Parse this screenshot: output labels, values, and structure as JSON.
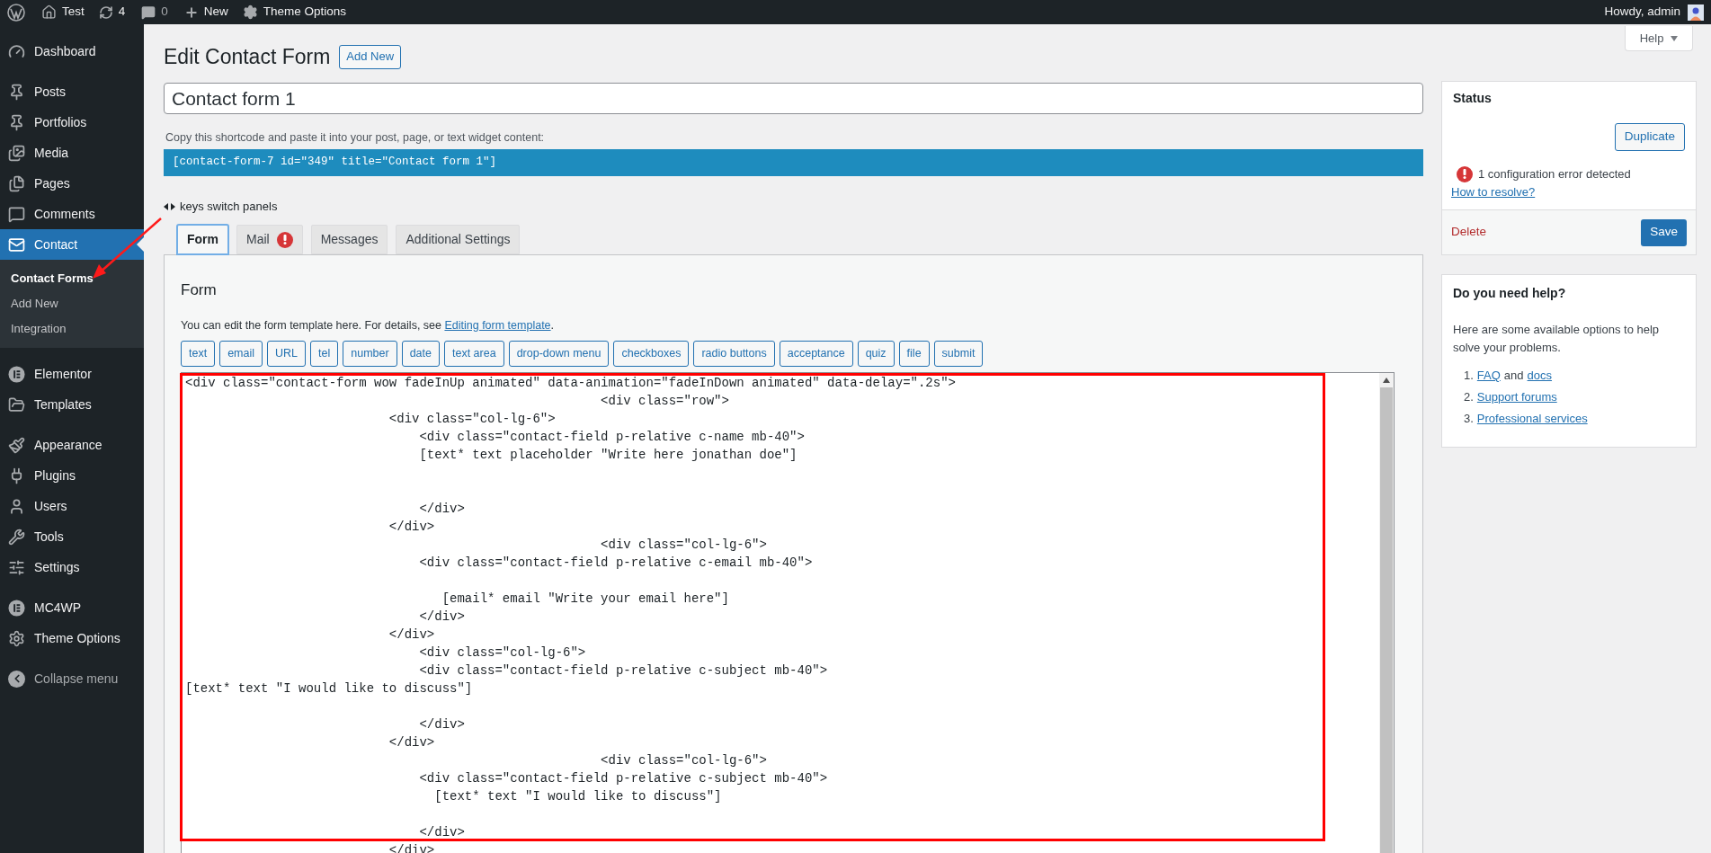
{
  "admin_bar": {
    "site": "Test",
    "updates": "4",
    "comments": "0",
    "new": "New",
    "theme_options": "Theme Options",
    "greeting": "Howdy, admin"
  },
  "sidebar": {
    "groups": [
      {
        "items": [
          {
            "label": "Dashboard",
            "selected": false
          }
        ]
      },
      {
        "items": [
          {
            "label": "Posts",
            "selected": false
          },
          {
            "label": "Portfolios",
            "selected": false
          },
          {
            "label": "Media",
            "selected": false
          },
          {
            "label": "Pages",
            "selected": false
          },
          {
            "label": "Comments",
            "selected": false
          },
          {
            "label": "Contact",
            "selected": true,
            "children": [
              {
                "label": "Contact Forms",
                "selected": true
              },
              {
                "label": "Add New",
                "selected": false
              },
              {
                "label": "Integration",
                "selected": false
              }
            ]
          }
        ]
      },
      {
        "items": [
          {
            "label": "Elementor",
            "selected": false
          },
          {
            "label": "Templates",
            "selected": false
          }
        ]
      },
      {
        "items": [
          {
            "label": "Appearance",
            "selected": false
          },
          {
            "label": "Plugins",
            "selected": false
          },
          {
            "label": "Users",
            "selected": false
          },
          {
            "label": "Tools",
            "selected": false
          },
          {
            "label": "Settings",
            "selected": false
          }
        ]
      },
      {
        "items": [
          {
            "label": "MC4WP",
            "selected": false
          },
          {
            "label": "Theme Options",
            "selected": false
          }
        ]
      }
    ],
    "collapse": "Collapse menu"
  },
  "help_tab": "Help",
  "page": {
    "title": "Edit Contact Form",
    "add_new": "Add New"
  },
  "form_title": {
    "value": "Contact form 1"
  },
  "shortcode": {
    "caption": "Copy this shortcode and paste it into your post, page, or text widget content:",
    "value": "[contact-form-7 id=\"349\" title=\"Contact form 1\"]"
  },
  "keys_hint": "keys switch panels",
  "tabs": [
    {
      "label": "Form",
      "selected": true,
      "error": false
    },
    {
      "label": "Mail",
      "selected": false,
      "error": true
    },
    {
      "label": "Messages",
      "selected": false,
      "error": false
    },
    {
      "label": "Additional Settings",
      "selected": false,
      "error": false
    }
  ],
  "form_panel": {
    "heading": "Form",
    "description": "You can edit the form template here. For details, see ",
    "description_link": "Editing form template",
    "description_end": ".",
    "tags": [
      "text",
      "email",
      "URL",
      "tel",
      "number",
      "date",
      "text area",
      "drop-down menu",
      "checkboxes",
      "radio buttons",
      "acceptance",
      "quiz",
      "file",
      "submit"
    ],
    "template": "<div class=\"contact-form wow fadeInUp animated\" data-animation=\"fadeInDown animated\" data-delay=\".2s\">\n                                                       <div class=\"row\">\n                           <div class=\"col-lg-6\">\n                               <div class=\"contact-field p-relative c-name mb-40\">\n                               [text* text placeholder \"Write here jonathan doe\"]\n\n\n                               </div>\n                           </div>\n                                                       <div class=\"col-lg-6\">\n                               <div class=\"contact-field p-relative c-email mb-40\">\n\n                                  [email* email \"Write your email here\"]\n                               </div>\n                           </div>\n                               <div class=\"col-lg-6\">\n                               <div class=\"contact-field p-relative c-subject mb-40\">\n[text* text \"I would like to discuss\"]\n\n                               </div>\n                           </div>\n                                                       <div class=\"col-lg-6\">\n                               <div class=\"contact-field p-relative c-subject mb-40\">\n                                 [text* text \"I would like to discuss\"]\n\n                               </div>\n                           </div>"
  },
  "status": {
    "title": "Status",
    "duplicate": "Duplicate",
    "error": "1 configuration error detected",
    "resolve": "How to resolve?",
    "delete": "Delete",
    "save": "Save"
  },
  "help_box": {
    "title": "Do you need help?",
    "text": "Here are some available options to help solve your problems.",
    "items": [
      {
        "number": "1.",
        "parts": [
          {
            "text": "FAQ",
            "link": true
          },
          {
            "text": "and",
            "link": false
          },
          {
            "text": "docs",
            "link": true
          }
        ]
      },
      {
        "number": "2.",
        "parts": [
          {
            "text": "Support forums",
            "link": true
          }
        ]
      },
      {
        "number": "3.",
        "parts": [
          {
            "text": "Professional services",
            "link": true
          }
        ]
      }
    ]
  }
}
